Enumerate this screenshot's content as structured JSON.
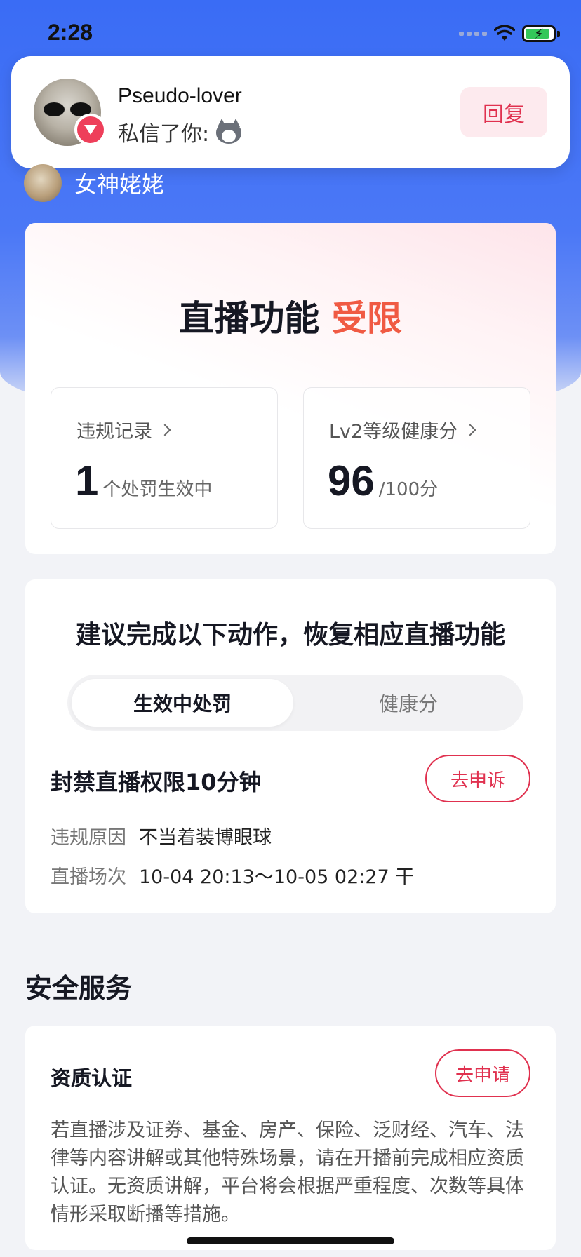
{
  "status_bar": {
    "time": "2:28"
  },
  "notification": {
    "sender": "Pseudo-lover",
    "message": "私信了你:",
    "reply_label": "回复"
  },
  "host": {
    "name": "女神姥姥"
  },
  "status_card": {
    "title": "直播功能",
    "title_highlight": "受限",
    "violations": {
      "label": "违规记录",
      "value": "1",
      "unit": "个处罚生效中"
    },
    "health": {
      "label": "Lv2等级健康分",
      "value": "96",
      "unit": "/100分"
    }
  },
  "actions_card": {
    "title": "建议完成以下动作，恢复相应直播功能",
    "tabs": [
      {
        "label": "生效中处罚",
        "active": true
      },
      {
        "label": "健康分",
        "active": false
      }
    ],
    "penalty": {
      "title": "封禁直播权限10分钟",
      "appeal_label": "去申诉",
      "reason_key": "违规原因",
      "reason_value": "不当着装博眼球",
      "session_key": "直播场次",
      "session_value": "10-04 20:13～10-05 02:27 干"
    }
  },
  "security": {
    "section_title": "安全服务",
    "qualification": {
      "title": "资质认证",
      "apply_label": "去申请",
      "description": "若直播涉及证券、基金、房产、保险、泛财经、汽车、法律等内容讲解或其他特殊场景，请在开播前完成相应资质认证。无资质讲解，平台将会根据严重程度、次数等具体情形采取断播等措施。"
    }
  },
  "colors": {
    "accent": "#e0314f",
    "highlight": "#f05a43",
    "hero": "#3a6cf5"
  }
}
